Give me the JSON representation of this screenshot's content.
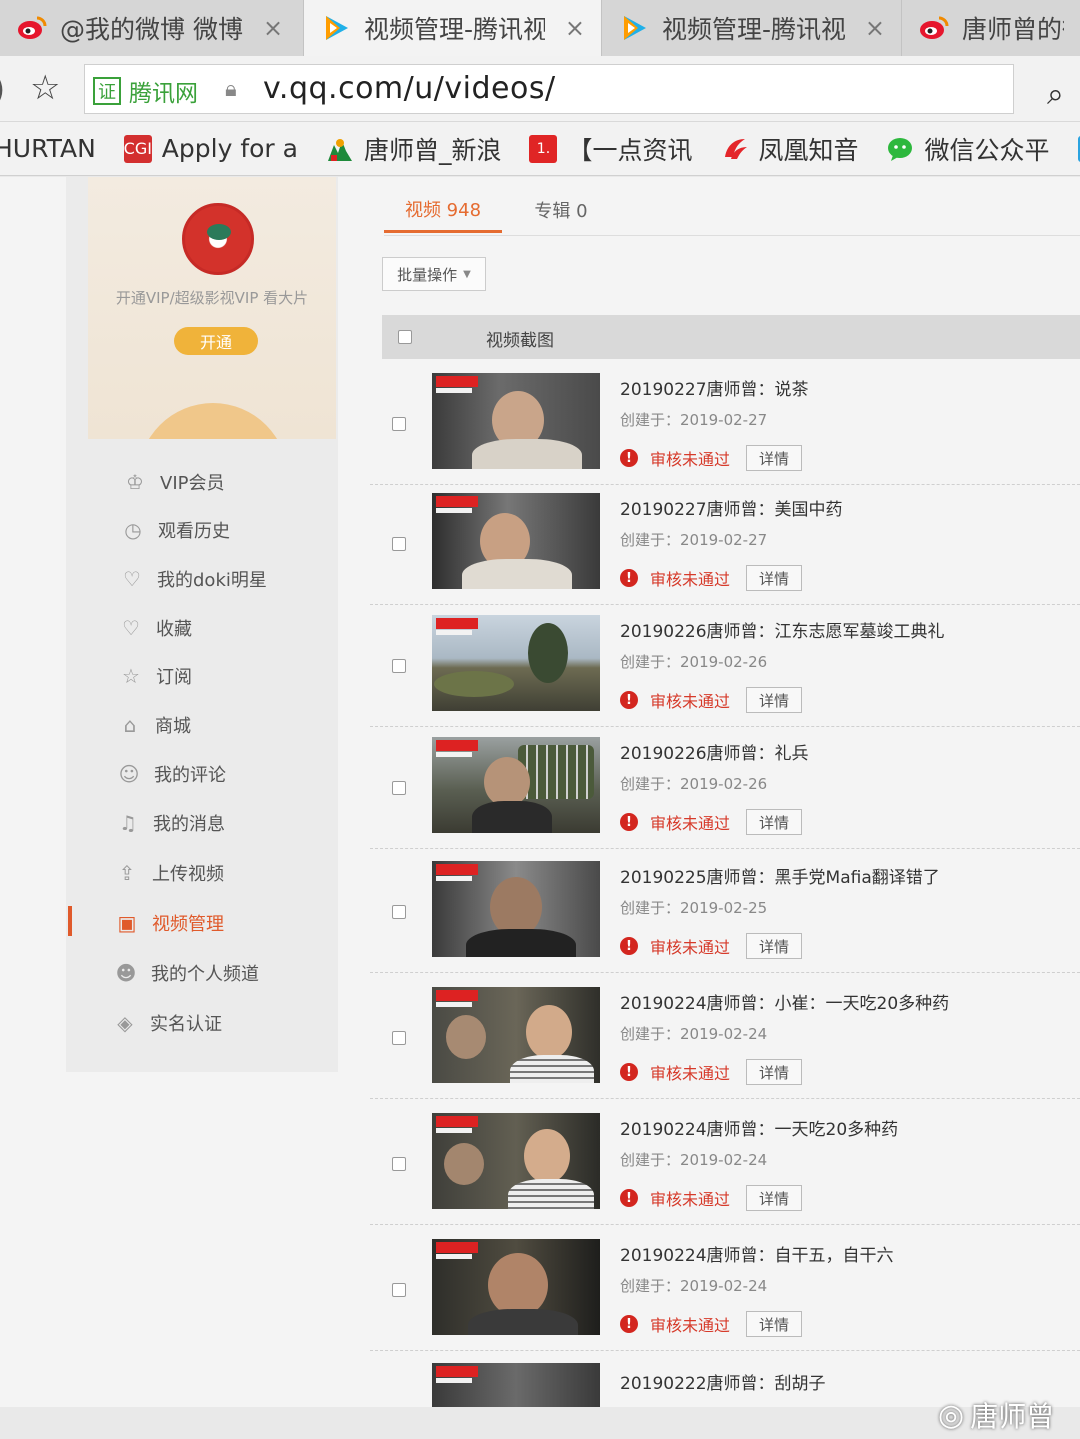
{
  "browser": {
    "tabs": [
      {
        "label": "@我的微博 微博",
        "icon": "weibo-icon",
        "close": "×"
      },
      {
        "label": "视频管理-腾讯视",
        "icon": "tencent-video-icon",
        "close": "×"
      },
      {
        "label": "视频管理-腾讯视",
        "icon": "tencent-video-icon",
        "close": "×"
      },
      {
        "label": "唐师曾的微",
        "icon": "weibo-icon",
        "close": ""
      }
    ],
    "address": {
      "cert_label": "证",
      "cert_site": "腾讯网",
      "url": "v.qq.com/u/videos/"
    },
    "bookmarks": [
      {
        "label": "HURTAN",
        "icon": ""
      },
      {
        "label": "Apply for a",
        "icon": "cgi-icon",
        "icon_text": "CGI"
      },
      {
        "label": "唐师曾_新浪",
        "icon": "sina-icon"
      },
      {
        "label": "【一点资讯",
        "icon": "yidian-icon",
        "icon_text": "1."
      },
      {
        "label": "凤凰知音",
        "icon": "phoenix-icon"
      },
      {
        "label": "微信公众平",
        "icon": "wechat-icon"
      }
    ]
  },
  "sidebar": {
    "vip_text": "开通VIP/超级影视VIP 看大片",
    "open_button": "开通",
    "items": [
      {
        "label": "VIP会员",
        "icon": "crown-icon",
        "glyph": "♔"
      },
      {
        "label": "观看历史",
        "icon": "clock-icon",
        "glyph": "◷"
      },
      {
        "label": "我的doki明星",
        "icon": "heart-icon",
        "glyph": "♡"
      },
      {
        "label": "收藏",
        "icon": "favorite-icon",
        "glyph": "♡"
      },
      {
        "label": "订阅",
        "icon": "star-icon",
        "glyph": "☆"
      },
      {
        "label": "商城",
        "icon": "shop-icon",
        "glyph": "⌂"
      },
      {
        "label": "我的评论",
        "icon": "comment-icon",
        "glyph": "☺"
      },
      {
        "label": "我的消息",
        "icon": "bell-icon",
        "glyph": "♫"
      },
      {
        "label": "上传视频",
        "icon": "upload-icon",
        "glyph": "⇪"
      },
      {
        "label": "视频管理",
        "icon": "folder-icon",
        "glyph": "▣",
        "active": true
      },
      {
        "label": "我的个人频道",
        "icon": "user-icon",
        "glyph": "☻"
      },
      {
        "label": "实名认证",
        "icon": "shield-icon",
        "glyph": "◈"
      }
    ]
  },
  "main": {
    "tabs": [
      {
        "label": "视频 948",
        "active": true
      },
      {
        "label": "专辑 0",
        "active": false
      }
    ],
    "batch_button": "批量操作",
    "table_header": "视频截图",
    "status_text": "审核未通过",
    "detail_label": "详情",
    "videos": [
      {
        "title": "20190227唐师曾：说茶",
        "created": "创建于：2019-02-27"
      },
      {
        "title": "20190227唐师曾：美国中药",
        "created": "创建于：2019-02-27"
      },
      {
        "title": "20190226唐师曾：江东志愿军墓竣工典礼",
        "created": "创建于：2019-02-26"
      },
      {
        "title": "20190226唐师曾：礼兵",
        "created": "创建于：2019-02-26"
      },
      {
        "title": "20190225唐师曾：黑手党Mafia翻译错了",
        "created": "创建于：2019-02-25"
      },
      {
        "title": "20190224唐师曾：小崔：一天吃20多种药",
        "created": "创建于：2019-02-24"
      },
      {
        "title": "20190224唐师曾：一天吃20多种药",
        "created": "创建于：2019-02-24"
      },
      {
        "title": "20190224唐师曾：自干五，自干六",
        "created": "创建于：2019-02-24"
      },
      {
        "title": "20190222唐师曾：刮胡子",
        "created": ""
      }
    ]
  },
  "watermark": "唐师曾"
}
